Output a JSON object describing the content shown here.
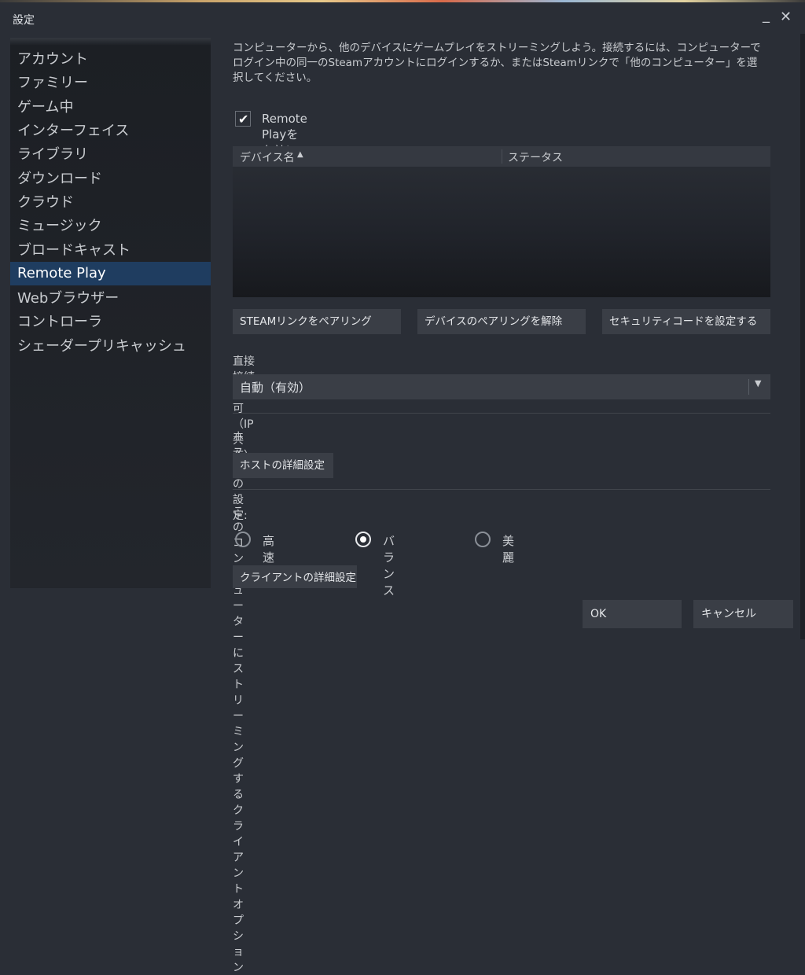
{
  "window": {
    "title": "設定",
    "minimize_icon": "_",
    "close_icon": "✕"
  },
  "sidebar": {
    "items": [
      {
        "label": "アカウント"
      },
      {
        "label": "ファミリー"
      },
      {
        "label": "ゲーム中"
      },
      {
        "label": "インターフェイス"
      },
      {
        "label": "ライブラリ"
      },
      {
        "label": "ダウンロード"
      },
      {
        "label": "クラウド"
      },
      {
        "label": "ミュージック"
      },
      {
        "label": "ブロードキャスト"
      },
      {
        "label": "Remote Play",
        "active": true
      },
      {
        "label": "Webブラウザー"
      },
      {
        "label": "コントローラ"
      },
      {
        "label": "シェーダープリキャッシュ"
      }
    ]
  },
  "remote_play": {
    "description": "コンピューターから、他のデバイスにゲームプレイをストリーミングしよう。接続するには、コンピューターでログイン中の同一のSteamアカウントにログインするか、またはSteamリンクで「他のコンピューター」を選択してください。",
    "enable_checkbox": {
      "label": "Remote Playを有効にする",
      "checked": true
    },
    "device_table": {
      "columns": [
        "デバイス名",
        "ステータス"
      ],
      "sort_icon": "▲",
      "rows": []
    },
    "buttons": {
      "pair_steam_link": "STEAMリンクをペアリング",
      "unpair_devices": "デバイスのペアリングを解除",
      "set_security_code": "セキュリティコードを設定する"
    },
    "direct_connection": {
      "label": "直接接続を許可（IP共有）",
      "value": "自動（有効）",
      "arrow_icon": "▼"
    },
    "host_settings": {
      "label": "ホストの設定:",
      "button": "ホストの詳細設定"
    },
    "client_options": {
      "label": "このコンピューターにストリーミングするクライアントオプション",
      "options": [
        {
          "label": "高速",
          "selected": false
        },
        {
          "label": "バランス",
          "selected": true
        },
        {
          "label": "美麗",
          "selected": false
        }
      ],
      "button": "クライアントの詳細設定"
    }
  },
  "footer": {
    "ok": "OK",
    "cancel": "キャンセル"
  }
}
